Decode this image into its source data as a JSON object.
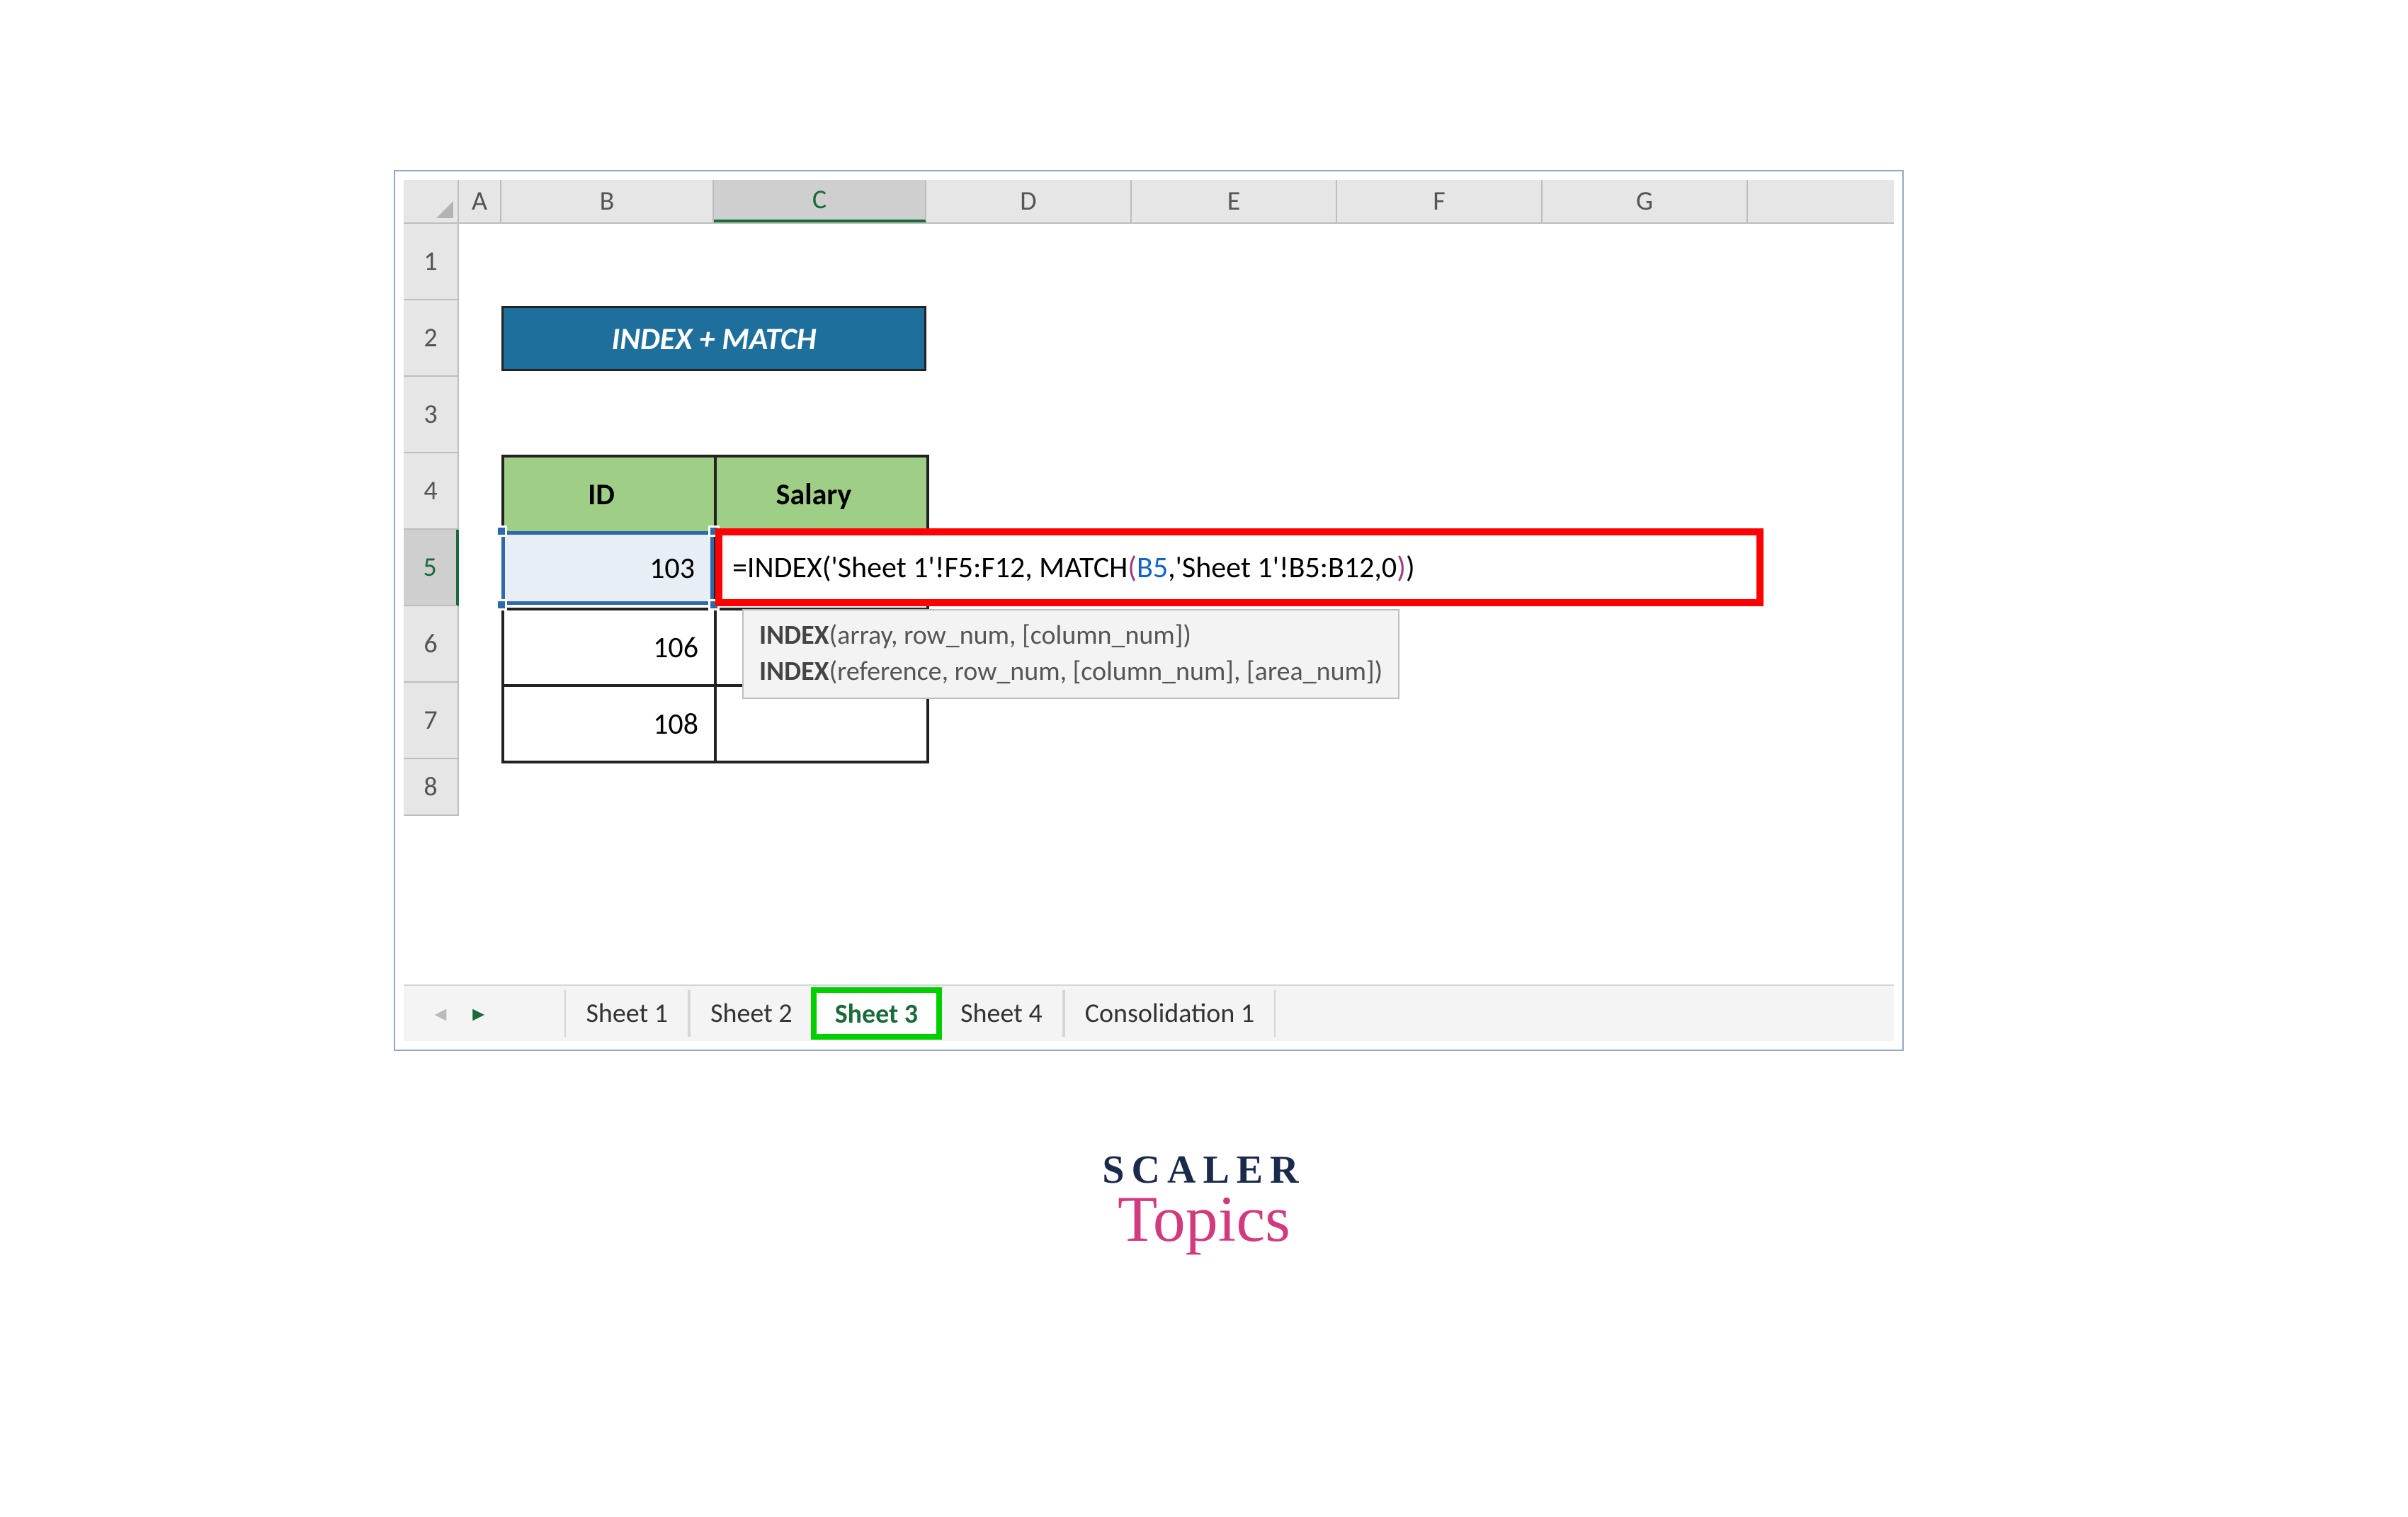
{
  "columns": [
    "A",
    "B",
    "C",
    "D",
    "E",
    "F",
    "G"
  ],
  "rows": [
    "1",
    "2",
    "3",
    "4",
    "5",
    "6",
    "7",
    "8"
  ],
  "active_col": "C",
  "active_row": "5",
  "title": "INDEX + MATCH",
  "table": {
    "headers": [
      "ID",
      "Salary"
    ],
    "rows": [
      {
        "id": "103",
        "salary": ""
      },
      {
        "id": "106",
        "salary": ""
      },
      {
        "id": "108",
        "salary": ""
      }
    ]
  },
  "selected_b5": "103",
  "formula": {
    "p1": "=INDEX('Sheet 1'!F5:F12, MATCH",
    "p2": "(",
    "p3": "B5",
    "p4": ",'Sheet 1'!B5:B12,0",
    "p5": ")",
    "p6": ")"
  },
  "tooltip": {
    "l1b": "INDEX",
    "l1": "(array, row_num, [column_num])",
    "l2b": "INDEX",
    "l2": "(reference, row_num, [column_num], [area_num])"
  },
  "tabs": [
    "Sheet 1",
    "Sheet 2",
    "Sheet 3",
    "Sheet 4",
    "Consolidation 1"
  ],
  "active_tab": "Sheet 3",
  "logo": {
    "top": "SCALER",
    "bottom": "Topics"
  }
}
